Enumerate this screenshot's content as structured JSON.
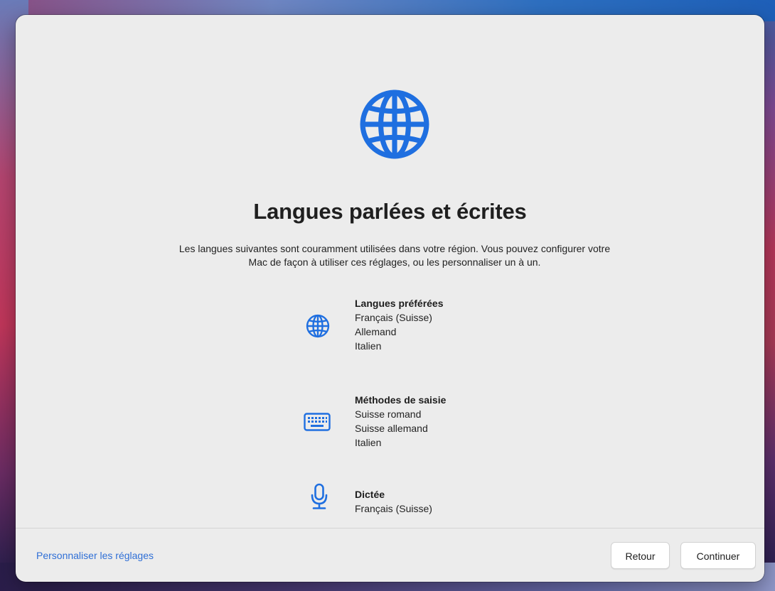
{
  "window": {
    "title": "Langues parlées et écrites",
    "description": "Les langues suivantes sont couramment utilisées dans votre région. Vous pouvez configurer votre Mac de façon à utiliser ces réglages, ou les personnaliser un à un."
  },
  "icons": {
    "hero": "globe-icon",
    "languages": "globe-icon",
    "input": "keyboard-icon",
    "dictation": "microphone-icon"
  },
  "sections": {
    "languages": {
      "heading": "Langues préférées",
      "items": [
        "Français (Suisse)",
        "Allemand",
        "Italien"
      ]
    },
    "input_methods": {
      "heading": "Méthodes de saisie",
      "items": [
        "Suisse romand",
        "Suisse allemand",
        "Italien"
      ]
    },
    "dictation": {
      "heading": "Dictée",
      "items": [
        "Français (Suisse)"
      ]
    }
  },
  "footer": {
    "customize_link": "Personnaliser les réglages",
    "back_label": "Retour",
    "continue_label": "Continuer"
  },
  "colors": {
    "accent": "#1f6fe0",
    "link": "#2f6fd6",
    "window_bg": "#ececec"
  }
}
